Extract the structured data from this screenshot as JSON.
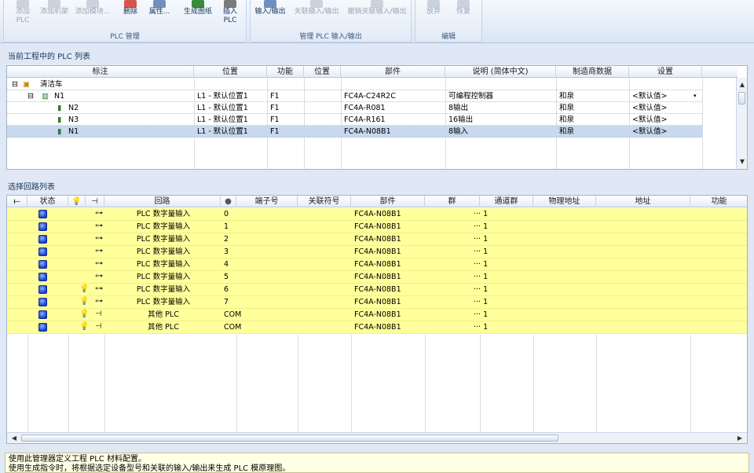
{
  "ribbon": {
    "plc_group": {
      "label": "PLC 管理",
      "add_plc": "添加\nPLC",
      "add_rack": "添加机架",
      "add_module": "添加模块...",
      "delete": "删除",
      "properties": "属性...",
      "generate_drawing": "生成图纸",
      "insert_plc": "插入\nPLC"
    },
    "io_group": {
      "label": "管理 PLC 输入/输出",
      "io": "输入/输出",
      "assoc_io": "关联输入/输出",
      "cancel_assoc_io": "撤销关联输入/输出"
    },
    "edit_group": {
      "label": "编辑",
      "discard": "放弃",
      "restore": "恢复"
    }
  },
  "plc_list": {
    "title": "当前工程中的 PLC 列表",
    "columns": [
      "标注",
      "位置",
      "功能",
      "位置",
      "部件",
      "说明 (简体中文)",
      "制造商数据",
      "设置"
    ],
    "root_label": "清洁车",
    "rows": [
      {
        "tag": "N1",
        "location": "L1 - 默认位置1",
        "function": "F1",
        "position": "",
        "part": "FC4A-C24R2C",
        "description": "可编程控制器",
        "manufacturer": "和泉",
        "setting": "<默认值>"
      },
      {
        "tag": "N2",
        "location": "L1 - 默认位置1",
        "function": "F1",
        "position": "",
        "part": "FC4A-R081",
        "description": "8输出",
        "manufacturer": "和泉",
        "setting": "<默认值>"
      },
      {
        "tag": "N3",
        "location": "L1 - 默认位置1",
        "function": "F1",
        "position": "",
        "part": "FC4A-R161",
        "description": "16输出",
        "manufacturer": "和泉",
        "setting": "<默认值>"
      },
      {
        "tag": "N1",
        "location": "L1 - 默认位置1",
        "function": "F1",
        "position": "",
        "part": "FC4A-N08B1",
        "description": "8输入",
        "manufacturer": "和泉",
        "setting": "<默认值>"
      }
    ]
  },
  "circuit_list": {
    "title": "选择回路列表",
    "columns": [
      "状态",
      "回路",
      "端子号",
      "关联符号",
      "部件",
      "群",
      "通道群",
      "物理地址",
      "地址",
      "功能"
    ],
    "rows": [
      {
        "circuit": "PLC 数字量输入",
        "terminal": "0",
        "part": "FC4A-N08B1",
        "group": "··· 1",
        "bulb": false
      },
      {
        "circuit": "PLC 数字量输入",
        "terminal": "1",
        "part": "FC4A-N08B1",
        "group": "··· 1",
        "bulb": false
      },
      {
        "circuit": "PLC 数字量输入",
        "terminal": "2",
        "part": "FC4A-N08B1",
        "group": "··· 1",
        "bulb": false
      },
      {
        "circuit": "PLC 数字量输入",
        "terminal": "3",
        "part": "FC4A-N08B1",
        "group": "··· 1",
        "bulb": false
      },
      {
        "circuit": "PLC 数字量输入",
        "terminal": "4",
        "part": "FC4A-N08B1",
        "group": "··· 1",
        "bulb": false
      },
      {
        "circuit": "PLC 数字量输入",
        "terminal": "5",
        "part": "FC4A-N08B1",
        "group": "··· 1",
        "bulb": false
      },
      {
        "circuit": "PLC 数字量输入",
        "terminal": "6",
        "part": "FC4A-N08B1",
        "group": "··· 1",
        "bulb": true
      },
      {
        "circuit": "PLC 数字量输入",
        "terminal": "7",
        "part": "FC4A-N08B1",
        "group": "··· 1",
        "bulb": true
      },
      {
        "circuit": "其他 PLC",
        "terminal": "COM",
        "part": "FC4A-N08B1",
        "group": "··· 1",
        "bulb": true
      },
      {
        "circuit": "其他 PLC",
        "terminal": "COM",
        "part": "FC4A-N08B1",
        "group": "··· 1",
        "bulb": true
      }
    ]
  },
  "message": {
    "line1": "使用此管理器定义工程 PLC 材料配置。",
    "line2": "使用生成指令时，将根据选定设备型号和关联的输入/输出来生成 PLC 模原理图。"
  },
  "colors": {
    "highlight_row": "#ffff9b",
    "selected_row": "#c7d8ef",
    "ribbon_text": "#15345c"
  }
}
